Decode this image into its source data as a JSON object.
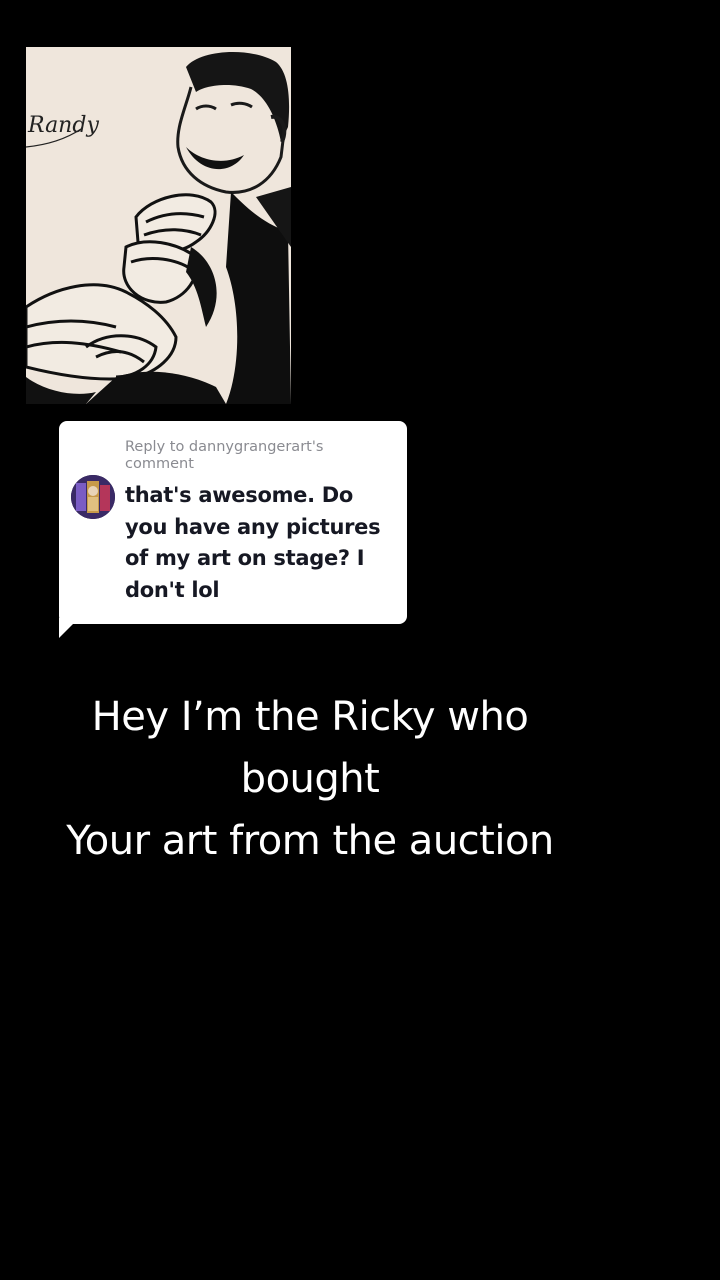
{
  "reply": {
    "header": "Reply to dannygrangerart's comment",
    "comment": "that's awesome. Do you have any pictures of my art on stage? I don't lol"
  },
  "caption": {
    "line1": "Hey I’m the Ricky who",
    "line2": "bought",
    "line3": "Your art from the auction"
  },
  "artwork": {
    "signature": "Randy"
  },
  "colors": {
    "background": "#000000",
    "bubble": "#ffffff",
    "header_text": "#8a8b91",
    "comment_text": "#161823",
    "caption_text": "#ffffff",
    "paper": "#efe6dc"
  }
}
